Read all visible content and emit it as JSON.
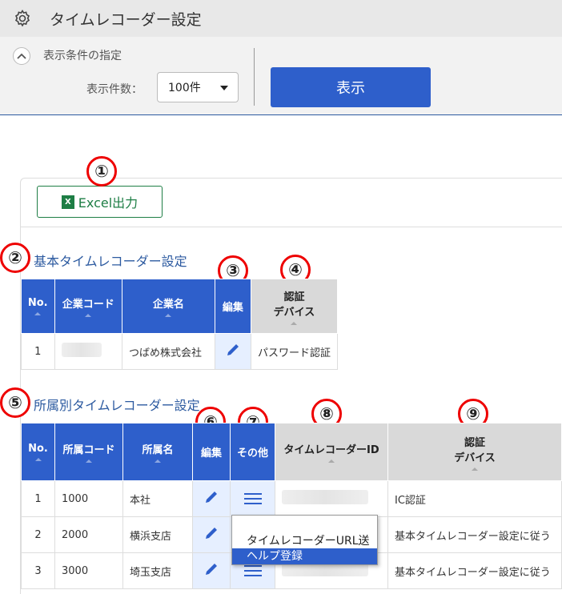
{
  "header": {
    "title": "タイムレコーダー設定",
    "icon": "gear-icon"
  },
  "filter": {
    "section_label": "表示条件の指定",
    "count_label": "表示件数：",
    "count_value": "100件",
    "show_button": "表示"
  },
  "excel_button": "Excel出力",
  "markers": [
    "①",
    "②",
    "③",
    "④",
    "⑤",
    "⑥",
    "⑦",
    "⑧",
    "⑨"
  ],
  "basic": {
    "title": "基本タイムレコーダー設定",
    "headers": {
      "no": "No.",
      "code": "企業コード",
      "name": "企業名",
      "edit": "編集",
      "auth1": "認証",
      "auth2": "デバイス"
    },
    "rows": [
      {
        "no": "1",
        "code": "",
        "name": "つばめ株式会社",
        "auth": "パスワード認証"
      }
    ]
  },
  "dept": {
    "title": "所属別タイムレコーダー設定",
    "headers": {
      "no": "No.",
      "code": "所属コード",
      "name": "所属名",
      "edit": "編集",
      "other": "その他",
      "id": "タイムレコーダーID",
      "auth1": "認証",
      "auth2": "デバイス"
    },
    "rows": [
      {
        "no": "1",
        "code": "1000",
        "name": "本社",
        "auth": "IC認証"
      },
      {
        "no": "2",
        "code": "2000",
        "name": "横浜支店",
        "auth": "基本タイムレコーダー設定に従う"
      },
      {
        "no": "3",
        "code": "3000",
        "name": "埼玉支店",
        "auth": "基本タイムレコーダー設定に従う"
      }
    ]
  },
  "dropdown": {
    "item1": "タイムレコーダーURL送信",
    "item2": "ヘルプ登録"
  },
  "colors": {
    "accent": "#2e5fcb",
    "excel": "#1e7e45",
    "marker": "#e00000"
  }
}
